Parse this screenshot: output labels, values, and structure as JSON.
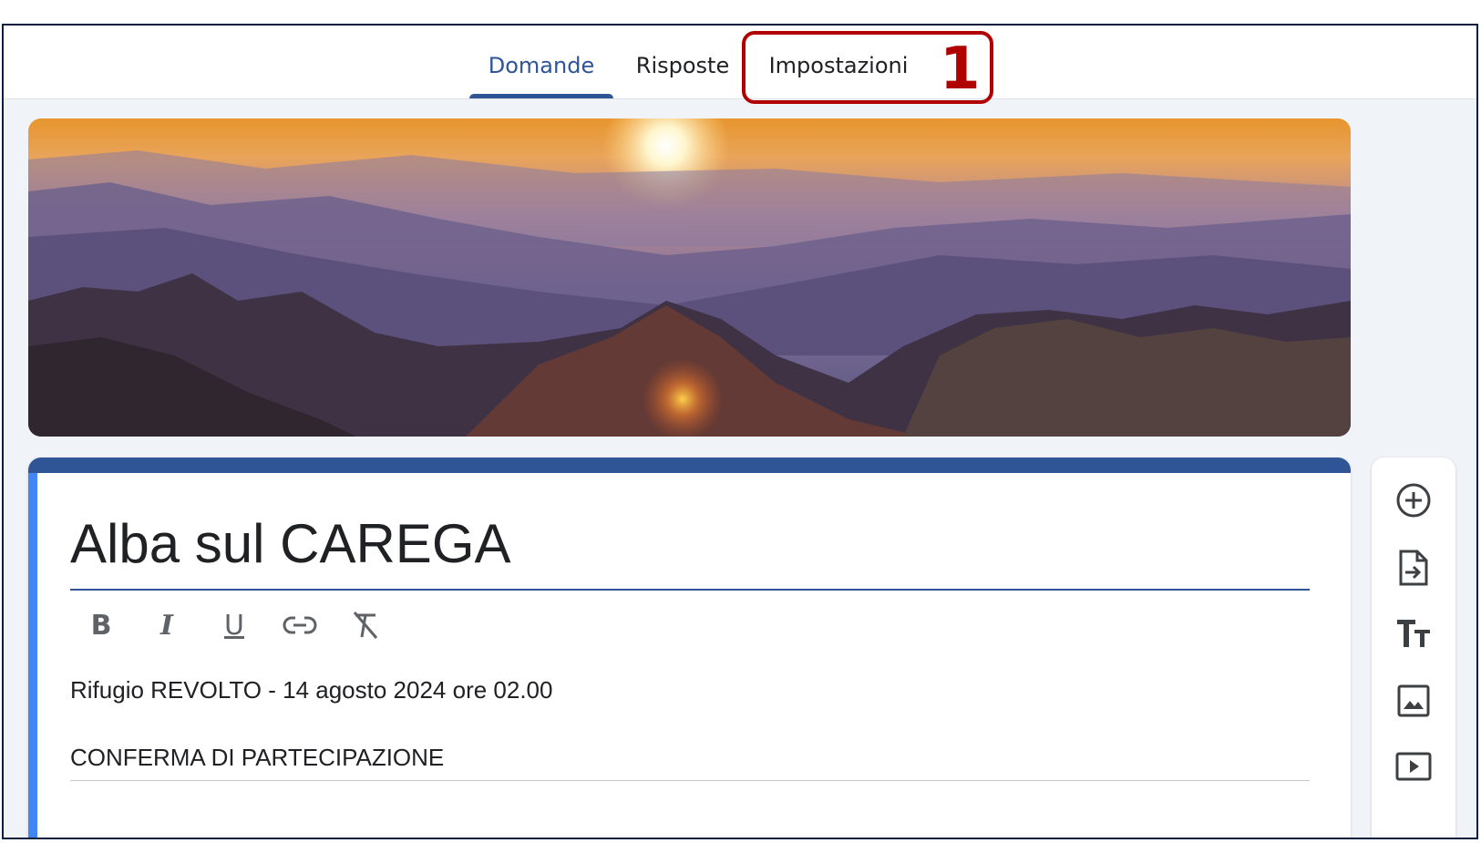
{
  "tabs": [
    {
      "label": "Domande",
      "active": true
    },
    {
      "label": "Risposte",
      "active": false
    },
    {
      "label": "Impostazioni",
      "active": false
    }
  ],
  "callout": {
    "number": "1",
    "color": "#b00000"
  },
  "form": {
    "title": "Alba sul CAREGA",
    "description_lines": [
      "Rifugio REVOLTO - 14 agosto 2024 ore 02.00",
      "CONFERMA DI PARTECIPAZIONE"
    ],
    "formatting_buttons": [
      "bold-icon",
      "italic-icon",
      "underline-icon",
      "link-icon",
      "clear-format-icon"
    ]
  },
  "side_toolbar": [
    "add-question-icon",
    "import-questions-icon",
    "add-title-icon",
    "add-image-icon",
    "add-video-icon"
  ],
  "colors": {
    "accent": "#2f5597",
    "card_left_accent": "#4285f4",
    "callout": "#b00000"
  }
}
